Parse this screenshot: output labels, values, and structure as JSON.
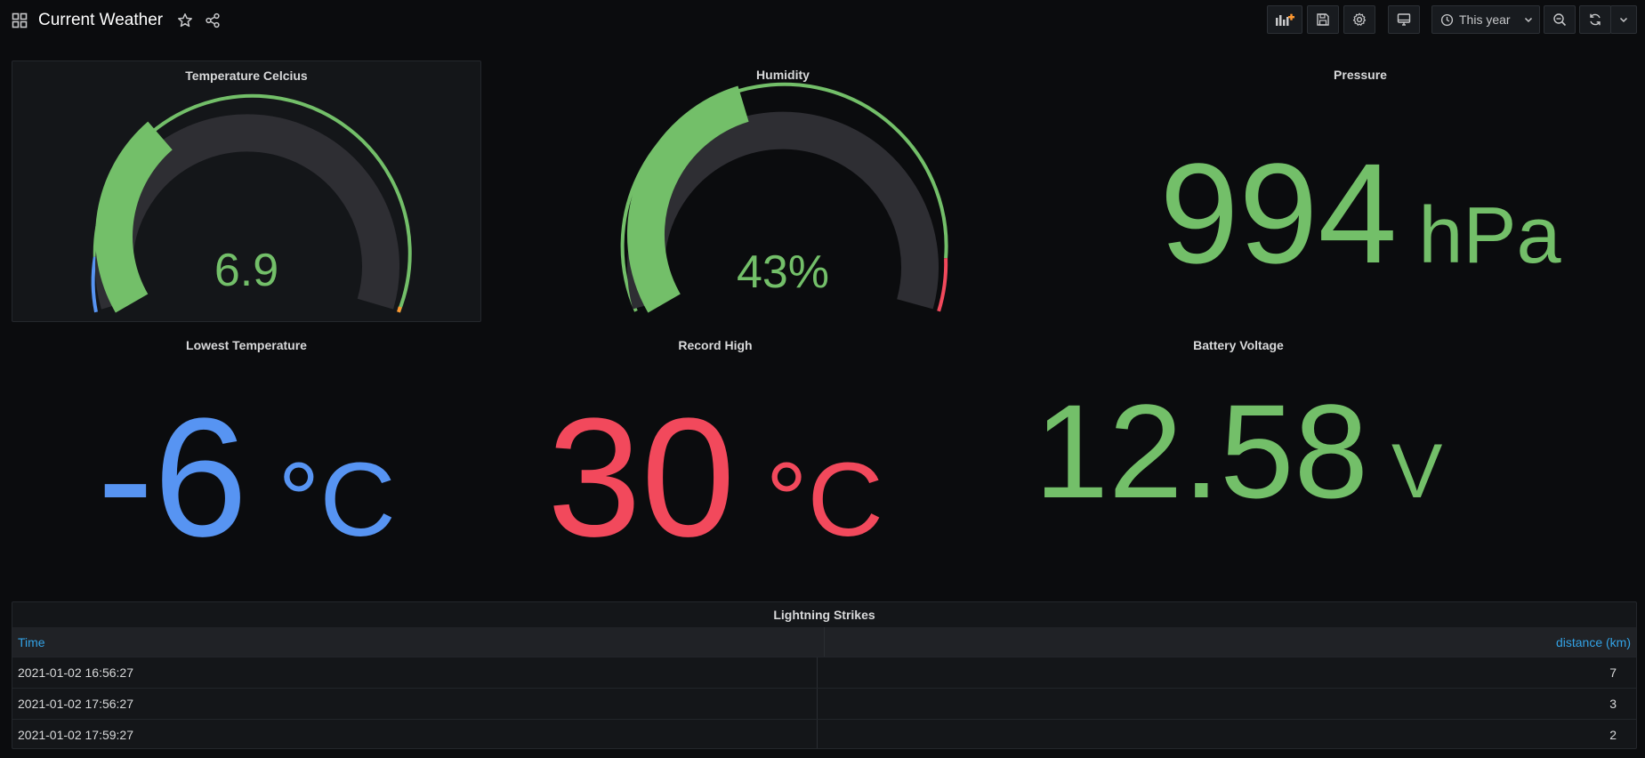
{
  "dashboard": {
    "title": "Current Weather",
    "time_range": "This year"
  },
  "icons": {
    "apps": "apps-grid-icon",
    "star": "star-icon",
    "share": "share-icon",
    "add_panel": "add-panel-icon",
    "save": "save-icon",
    "settings": "gear-icon",
    "tv_mode": "monitor-icon",
    "clock": "clock-icon",
    "chevron": "chevron-down-icon",
    "zoom_out": "zoom-out-icon",
    "refresh": "refresh-icon"
  },
  "colors": {
    "green": "#73bf69",
    "blue": "#5794f2",
    "red": "#f2495c",
    "link": "#33a2e5"
  },
  "panels": {
    "temperature": {
      "title": "Temperature Celcius",
      "value": "6.9",
      "gauge_fraction": 0.33
    },
    "humidity": {
      "title": "Humidity",
      "value": "43%",
      "gauge_fraction": 0.43
    },
    "pressure": {
      "title": "Pressure",
      "value": "994",
      "unit": "hPa"
    },
    "lowest": {
      "title": "Lowest Temperature",
      "value": "-6",
      "unit": "°C"
    },
    "record_high": {
      "title": "Record High",
      "value": "30",
      "unit": "°C"
    },
    "battery": {
      "title": "Battery Voltage",
      "value": "12.58",
      "unit": "V"
    }
  },
  "lightning": {
    "title": "Lightning Strikes",
    "columns": [
      "Time",
      "distance (km)"
    ],
    "rows": [
      [
        "2021-01-02 16:56:27",
        "7"
      ],
      [
        "2021-01-02 17:56:27",
        "3"
      ],
      [
        "2021-01-02 17:59:27",
        "2"
      ]
    ]
  }
}
